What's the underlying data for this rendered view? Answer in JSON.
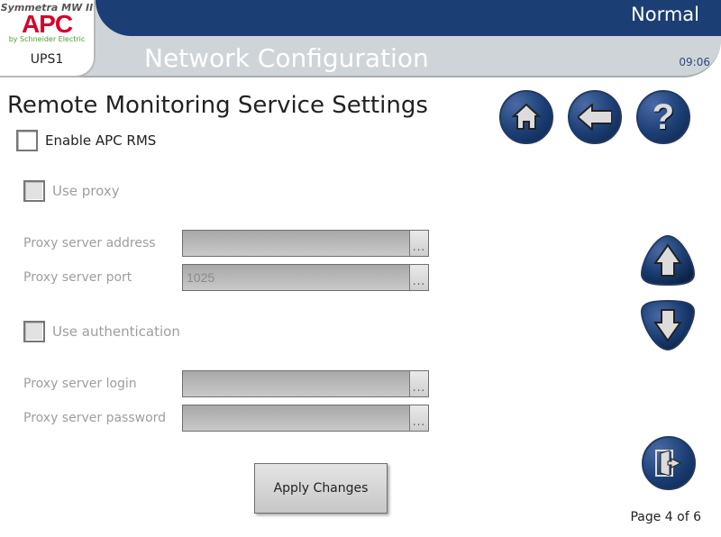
{
  "header": {
    "product_line": "Symmetra MW II",
    "brand": "APC",
    "schneider": "by Schneider Electric",
    "ups_name": "UPS1",
    "title": "Network Configuration",
    "status": "Normal",
    "time": "09:06"
  },
  "page": {
    "title": "Remote Monitoring Service Settings",
    "page_indicator": "Page 4 of 6"
  },
  "form": {
    "enable_rms": {
      "label": "Enable APC RMS",
      "checked": false,
      "enabled": true
    },
    "use_proxy": {
      "label": "Use proxy",
      "checked": false,
      "enabled": false
    },
    "proxy_address": {
      "label": "Proxy server address",
      "value": "",
      "enabled": false
    },
    "proxy_port": {
      "label": "Proxy server port",
      "value": "1025",
      "enabled": false
    },
    "use_auth": {
      "label": "Use authentication",
      "checked": false,
      "enabled": false
    },
    "proxy_login": {
      "label": "Proxy server login",
      "value": "",
      "enabled": false
    },
    "proxy_password": {
      "label": "Proxy server password",
      "value": "",
      "enabled": false
    },
    "apply_label": "Apply Changes"
  },
  "colors": {
    "brand_blue": "#1b3e74",
    "brand_red": "#d80029",
    "schneider_green": "#4a9e2a"
  }
}
